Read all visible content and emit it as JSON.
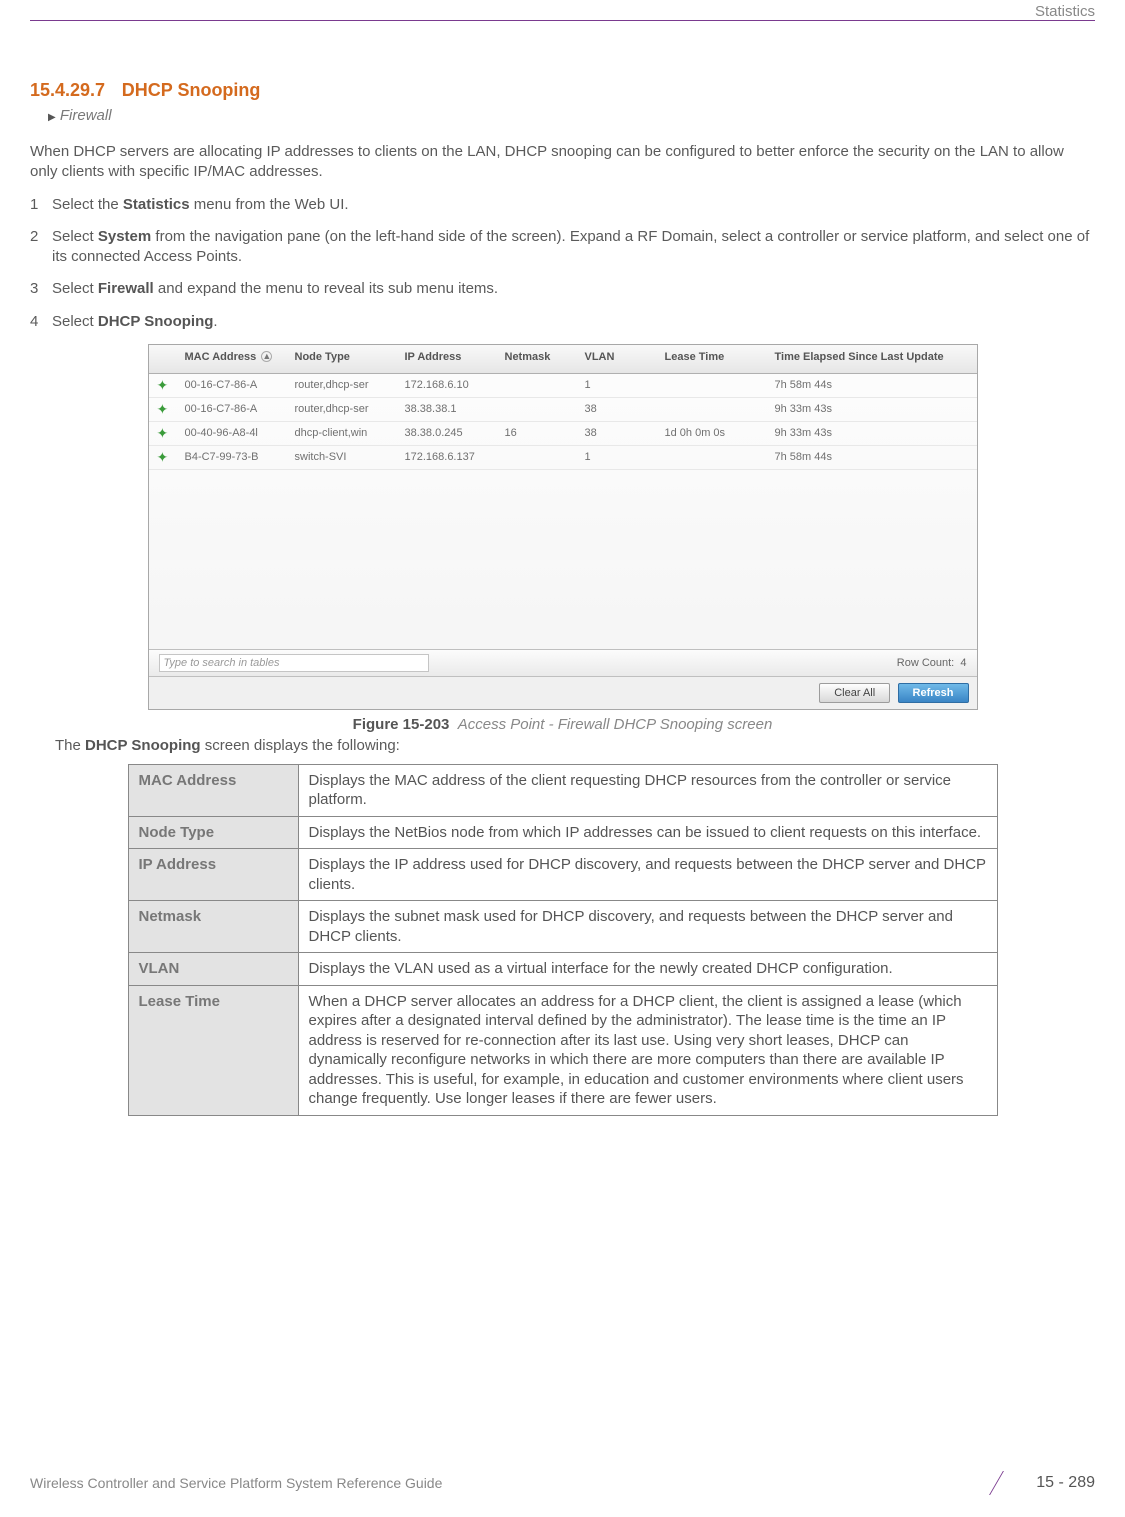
{
  "header": {
    "section_label": "Statistics"
  },
  "title": {
    "number": "15.4.29.7",
    "name": "DHCP Snooping"
  },
  "breadcrumb": {
    "arrow": "▶",
    "path": "Firewall"
  },
  "intro": "When DHCP servers are allocating IP addresses to clients on the LAN, DHCP snooping can be configured to better enforce the security on the LAN to allow only clients with specific IP/MAC addresses.",
  "steps": [
    {
      "n": "1",
      "pre": "Select the ",
      "kw1": "Statistics",
      "mid": " menu from the Web UI.",
      "kw2": "",
      "post": ""
    },
    {
      "n": "2",
      "pre": "Select ",
      "kw1": "System",
      "mid": " from the navigation pane (on the left-hand side of the screen). Expand a RF Domain, select a controller or service platform, and select one of its connected Access Points.",
      "kw2": "",
      "post": ""
    },
    {
      "n": "3",
      "pre": "Select ",
      "kw1": "Firewall",
      "mid": " and expand the menu to reveal its sub menu items.",
      "kw2": "",
      "post": ""
    },
    {
      "n": "4",
      "pre": "Select ",
      "kw1": "DHCP Snooping",
      "mid": ".",
      "kw2": "",
      "post": ""
    }
  ],
  "table_headers": {
    "mac": "MAC Address",
    "node": "Node Type",
    "ip": "IP Address",
    "mask": "Netmask",
    "vlan": "VLAN",
    "lease": "Lease Time",
    "elapsed": "Time Elapsed Since Last Update"
  },
  "rows": [
    {
      "mac": "00-16-C7-86-A",
      "node": "router,dhcp-ser",
      "ip": "172.168.6.10",
      "mask": "",
      "vlan": "1",
      "lease": "",
      "elapsed": "7h 58m 44s"
    },
    {
      "mac": "00-16-C7-86-A",
      "node": "router,dhcp-ser",
      "ip": "38.38.38.1",
      "mask": "",
      "vlan": "38",
      "lease": "",
      "elapsed": "9h 33m 43s"
    },
    {
      "mac": "00-40-96-A8-4l",
      "node": "dhcp-client,win",
      "ip": "38.38.0.245",
      "mask": "16",
      "vlan": "38",
      "lease": "1d 0h 0m 0s",
      "elapsed": "9h 33m 43s"
    },
    {
      "mac": "B4-C7-99-73-B",
      "node": "switch-SVI",
      "ip": "172.168.6.137",
      "mask": "",
      "vlan": "1",
      "lease": "",
      "elapsed": "7h 58m 44s"
    }
  ],
  "search_placeholder": "Type to search in tables",
  "row_count_label": "Row Count:",
  "row_count_value": "4",
  "buttons": {
    "clear": "Clear All",
    "refresh": "Refresh"
  },
  "figure": {
    "label": "Figure 15-203",
    "caption": "Access Point - Firewall DHCP Snooping screen"
  },
  "displays_pre": "The ",
  "displays_kw": "DHCP Snooping",
  "displays_post": " screen displays the following:",
  "desc": [
    {
      "term": "MAC Address",
      "def": "Displays the MAC address of the client requesting DHCP resources from the controller or service platform."
    },
    {
      "term": "Node Type",
      "def": "Displays the NetBios node from which IP addresses can be issued to client requests on this interface."
    },
    {
      "term": "IP Address",
      "def": "Displays the IP address used for DHCP discovery, and requests between the DHCP server and DHCP clients."
    },
    {
      "term": "Netmask",
      "def": "Displays the subnet mask used for DHCP discovery, and requests between the DHCP server and DHCP clients."
    },
    {
      "term": "VLAN",
      "def": "Displays the VLAN used as a virtual interface for the newly created DHCP configuration."
    },
    {
      "term": "Lease Time",
      "def": "When a DHCP server allocates an address for a DHCP client, the client is assigned a lease (which expires after a designated interval defined by the administrator). The lease time is the time an IP address is reserved for re-connection after its last use. Using very short leases, DHCP can dynamically reconfigure networks in which there are more computers than there are available IP addresses. This is useful, for example, in education and customer environments where client users change frequently. Use longer leases if there are fewer users."
    }
  ],
  "footer": {
    "left": "Wireless Controller and Service Platform System Reference Guide",
    "page": "15 - 289"
  }
}
